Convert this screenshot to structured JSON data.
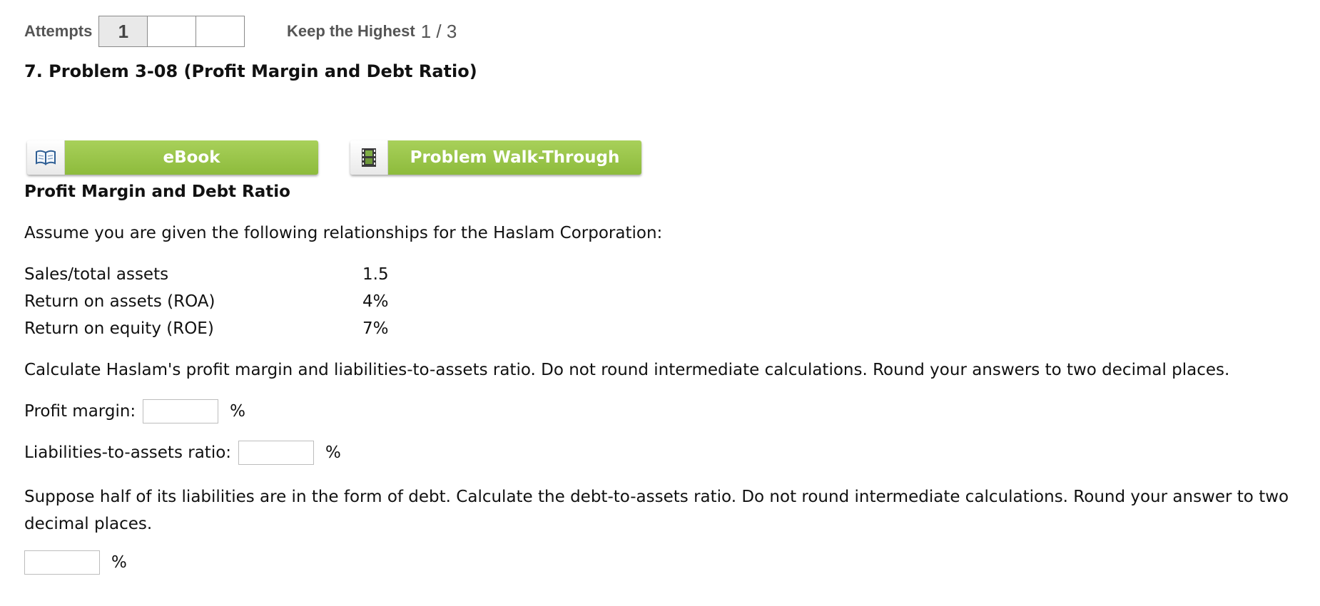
{
  "attempts": {
    "label": "Attempts",
    "boxes": [
      "1",
      "",
      ""
    ],
    "keep_label": "Keep the Highest",
    "keep_value": "1 / 3"
  },
  "question": {
    "title": "7.  Problem 3-08 (Profit Margin and Debt Ratio)"
  },
  "resources": {
    "ebook_label": "eBook",
    "walkthrough_label": "Problem Walk-Through"
  },
  "problem": {
    "section_title": "Profit Margin and Debt Ratio",
    "intro": "Assume you are given the following relationships for the Haslam Corporation:",
    "rows": [
      {
        "label": "Sales/total assets",
        "value": "1.5"
      },
      {
        "label": "Return on assets (ROA)",
        "value": "4%"
      },
      {
        "label": "Return on equity (ROE)",
        "value": "7%"
      }
    ],
    "instruction": "Calculate Haslam's profit margin and liabilities-to-assets ratio. Do not round intermediate calculations. Round your answers to two decimal places.",
    "answers": [
      {
        "label": "Profit margin:",
        "value": "",
        "unit": "%"
      },
      {
        "label": "Liabilities-to-assets ratio:",
        "value": "",
        "unit": "%"
      }
    ],
    "part2_text": "Suppose half of its liabilities are in the form of debt. Calculate the debt-to-assets ratio. Do not round intermediate calculations. Round your answer to two decimal places.",
    "part2_answer": {
      "value": "",
      "unit": "%"
    }
  },
  "icons": {
    "ebook": "book-icon",
    "walkthrough": "film-strip-icon"
  },
  "colors": {
    "button_green": "#97c247",
    "attempt_fill": "#e9e9e9",
    "label_gray": "#555555"
  }
}
